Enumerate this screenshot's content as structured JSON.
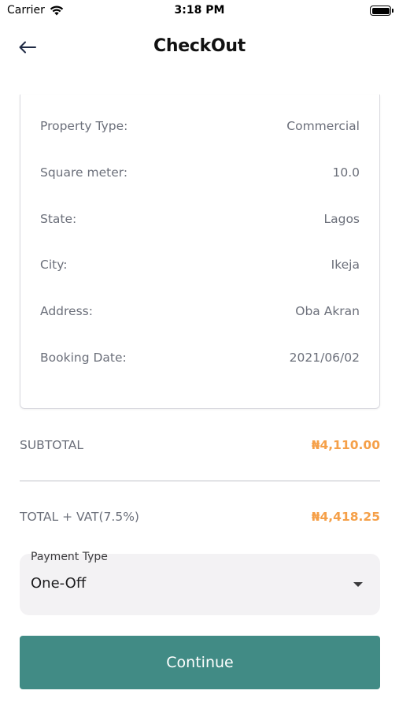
{
  "status_bar": {
    "carrier": "Carrier",
    "time": "3:18 PM"
  },
  "header": {
    "back_icon": "arrow-left-icon",
    "title": "CheckOut"
  },
  "details": [
    {
      "label": "Property Type:",
      "value": "Commercial"
    },
    {
      "label": "Square meter:",
      "value": "10.0"
    },
    {
      "label": "State:",
      "value": "Lagos"
    },
    {
      "label": "City:",
      "value": "Ikeja"
    },
    {
      "label": "Address:",
      "value": "Oba Akran"
    },
    {
      "label": "Booking Date:",
      "value": "2021/06/02"
    }
  ],
  "summary": {
    "subtotal_label": "SUBTOTAL",
    "subtotal_value": "₦4,110.00",
    "total_label": "TOTAL + VAT(7.5%)",
    "total_value": "₦4,418.25"
  },
  "payment": {
    "label": "Payment Type",
    "selected": "One-Off"
  },
  "continue_label": "Continue",
  "colors": {
    "accent": "#418b85",
    "amount": "#f5a049",
    "muted_text": "#6b6f7a"
  }
}
